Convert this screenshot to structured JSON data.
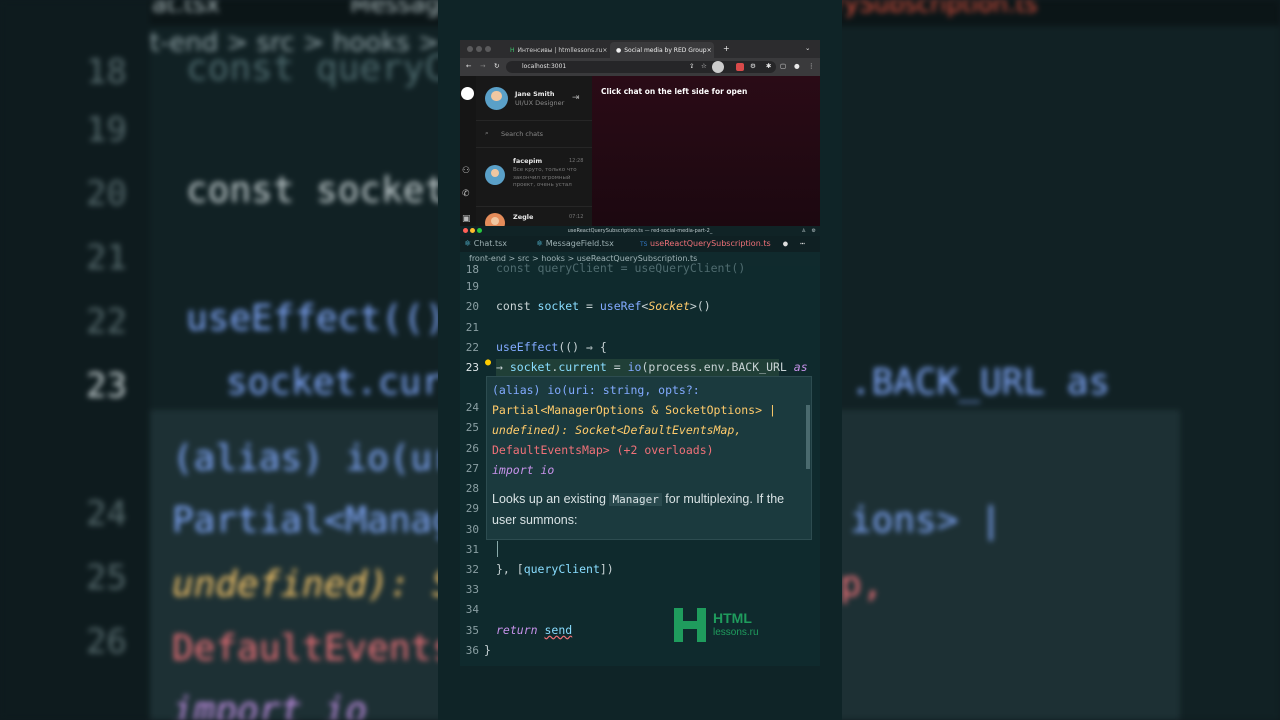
{
  "background": {
    "breadcrumb": "front-end > src > hooks > u",
    "tabs": [
      "Chat.tsx",
      "Message",
      "erySubscription.ts"
    ],
    "lines": [
      {
        "num": "18",
        "text": "const queryCli"
      },
      {
        "num": "19",
        "text": ""
      },
      {
        "num": "20",
        "text": "const socket"
      },
      {
        "num": "21",
        "text": ""
      },
      {
        "num": "22",
        "text": "useEffect(() "
      },
      {
        "num": "23",
        "text": "socket.curr"
      },
      {
        "num": "24",
        "text": "Partial<Manage"
      },
      {
        "num": "25",
        "text": "undefined): So"
      },
      {
        "num": "26",
        "text": "DefaultEventsM"
      },
      {
        "num": "",
        "text": "import io"
      }
    ],
    "right_lines": [
      ".BACK_URL as",
      "ions> |",
      "p,"
    ],
    "hover_first": "(alias) io(uri"
  },
  "browser": {
    "tabs": [
      {
        "label": "Интенсивы | htmllessons.ru",
        "active": false
      },
      {
        "label": "Social media by RED Group",
        "active": true
      }
    ],
    "new_tab": "+",
    "url": "localhost:3001",
    "user": {
      "name": "Jane Smith",
      "role": "UI/UX Designer"
    },
    "search_placeholder": "Search chats",
    "chats": [
      {
        "name": "facepim",
        "time": "12:28",
        "preview": "Все круто, только что закончил огромный проект, очень устал"
      },
      {
        "name": "Zegle",
        "time": "07:12",
        "preview": ""
      }
    ],
    "empty_message": "Click chat on the left side for open"
  },
  "editor": {
    "window_title": "useReactQuerySubscription.ts — red-social-media-part-2_",
    "tabs": [
      {
        "label": "Chat.tsx",
        "active": false
      },
      {
        "label": "MessageField.tsx",
        "active": false
      },
      {
        "label": "useReactQuerySubscription.ts",
        "active": true
      }
    ],
    "breadcrumbs": "front-end  >  src  >  hooks  >  useReactQuerySubscription.ts",
    "hover_signature": [
      "(alias) io(uri: string, opts?:",
      "Partial<ManagerOptions & SocketOptions> |",
      "undefined): Socket<DefaultEventsMap,",
      "DefaultEventsMap> (+2 overloads)",
      "import io"
    ],
    "hover_doc_before": "Looks up an existing",
    "hover_doc_code": "Manager",
    "hover_doc_after": "for multiplexing. If the user summons:",
    "numbers": [
      "18",
      "19",
      "20",
      "21",
      "22",
      "23",
      "24",
      "25",
      "26",
      "27",
      "28",
      "29",
      "30",
      "31",
      "32",
      "33",
      "34",
      "35",
      "36"
    ]
  },
  "watermark": {
    "line1": "HTML",
    "line2": "lessons.ru"
  }
}
